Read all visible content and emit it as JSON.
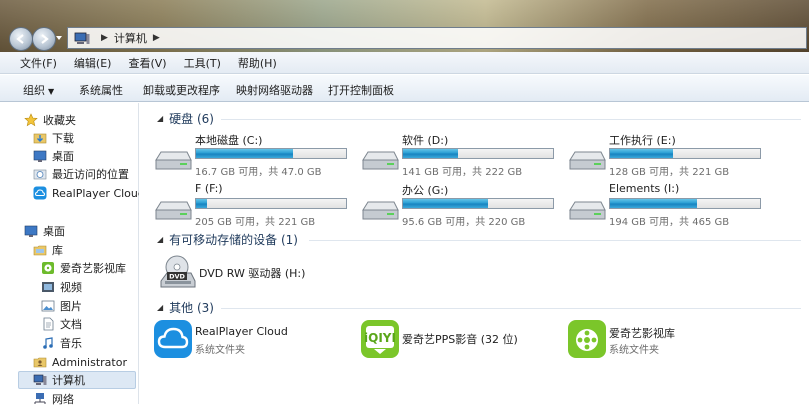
{
  "address": {
    "crumbs": [
      "计算机"
    ]
  },
  "menu": [
    "文件(F)",
    "编辑(E)",
    "查看(V)",
    "工具(T)",
    "帮助(H)"
  ],
  "commands": {
    "organize": "组织",
    "system_properties": "系统属性",
    "uninstall": "卸载或更改程序",
    "map_drive": "映射网络驱动器",
    "control_panel": "打开控制面板"
  },
  "nav": {
    "favorites": "收藏夹",
    "downloads": "下载",
    "desktop_fav": "桌面",
    "recent": "最近访问的位置",
    "realplayer": "RealPlayer Cloud",
    "desktop": "桌面",
    "libraries": "库",
    "iqiyi": "爱奇艺影视库",
    "videos": "视频",
    "pictures": "图片",
    "documents": "文档",
    "music": "音乐",
    "admin": "Administrator",
    "computer": "计算机",
    "network": "网络"
  },
  "groups": {
    "hdd": "硬盘 (6)",
    "removable": "有可移动存储的设备 (1)",
    "other": "其他 (3)"
  },
  "drives": [
    {
      "name": "本地磁盘 (C:)",
      "free": "16.7 GB 可用，共 47.0 GB",
      "used_fraction": 0.645
    },
    {
      "name": "软件 (D:)",
      "free": "141 GB 可用，共 222 GB",
      "used_fraction": 0.365
    },
    {
      "name": "工作执行 (E:)",
      "free": "128 GB 可用，共 221 GB",
      "used_fraction": 0.421
    },
    {
      "name": "F (F:)",
      "free": "205 GB 可用，共 221 GB",
      "used_fraction": 0.072
    },
    {
      "name": "办公 (G:)",
      "free": "95.6 GB 可用，共 220 GB",
      "used_fraction": 0.565
    },
    {
      "name": "Elements (I:)",
      "free": "194 GB 可用，共 465 GB",
      "used_fraction": 0.583
    }
  ],
  "dvd": {
    "name": "DVD RW 驱动器 (H:)"
  },
  "others": [
    {
      "name": "RealPlayer Cloud",
      "sub": "系统文件夹"
    },
    {
      "name": "爱奇艺PPS影音 (32 位)",
      "sub": ""
    },
    {
      "name": "爱奇艺影视库",
      "sub": "系统文件夹"
    }
  ],
  "colors": {
    "bar_fill": "#1a8fcb",
    "group_text": "#1e395b"
  }
}
